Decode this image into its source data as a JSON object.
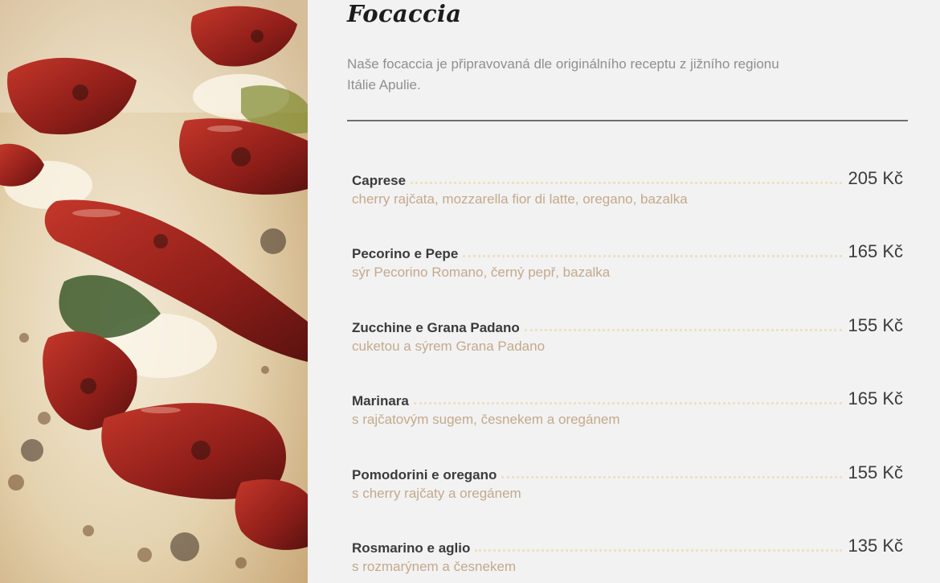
{
  "section": {
    "title": "Focaccia",
    "intro": "Naše focaccia je připravovaná dle originálního receptu z jižního regionu Itálie Apulie."
  },
  "menu": {
    "items": [
      {
        "name": "Caprese",
        "price": "205 Kč",
        "description": "cherry rajčata, mozzarella fior di latte, oregano, bazalka"
      },
      {
        "name": "Pecorino e Pepe",
        "price": "165 Kč",
        "description": "sýr Pecorino Romano, černý pepř, bazalka"
      },
      {
        "name": "Zucchine e Grana Padano",
        "price": "155 Kč",
        "description": "cuketou a sýrem Grana Padano"
      },
      {
        "name": "Marinara",
        "price": "165 Kč",
        "description": "s rajčatovým sugem, česnekem a oregánem"
      },
      {
        "name": "Pomodorini e oregano",
        "price": "155 Kč",
        "description": "s cherry rajčaty a oregánem"
      },
      {
        "name": "Rosmarino e aglio",
        "price": "135 Kč",
        "description": "s rozmarýnem a česnekem"
      }
    ]
  },
  "colors": {
    "background": "#f2f2f2",
    "title": "#1c1c1c",
    "intro_text": "#8f8f8f",
    "item_name": "#3b3b3b",
    "description": "#c4a98c",
    "dot_leader": "#ede0c4",
    "divider": "#6e6e6e"
  },
  "image": {
    "subject": "focaccia-with-sun-dried-tomatoes"
  }
}
